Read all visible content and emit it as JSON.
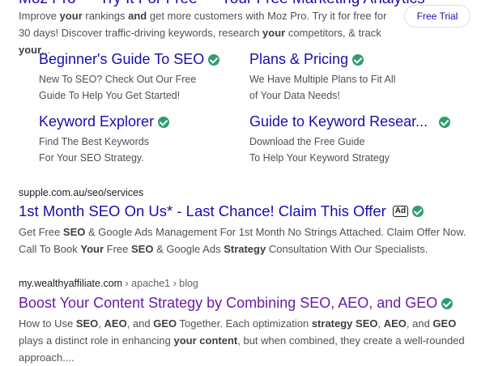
{
  "result_moz": {
    "title_clipped": "Moz Pro — Try It For Free — Your Free Marketing Analytics",
    "description_parts": [
      {
        "t": "Improve ",
        "b": false
      },
      {
        "t": "your",
        "b": true
      },
      {
        "t": " rankings ",
        "b": false
      },
      {
        "t": "and",
        "b": true
      },
      {
        "t": " get more customers with Moz Pro. Try it for free for 30 days! Discover traffic-driving keywords, research ",
        "b": false
      },
      {
        "t": "your",
        "b": true
      },
      {
        "t": " competitors, & track ",
        "b": false
      },
      {
        "t": "your",
        "b": true
      },
      {
        "t": "...",
        "b": false
      }
    ],
    "cta_label": "Free Trial",
    "sitelinks": [
      {
        "title": "Beginner's Guide To SEO",
        "line1": "New To SEO? Check Out Our Free",
        "line2": "Guide To Help You Get Started!"
      },
      {
        "title": "Plans & Pricing",
        "line1": "We Have Multiple Plans to Fit All",
        "line2": "of Your Data Needs!"
      },
      {
        "title": "Keyword Explorer",
        "line1": "Find The Best Keywords",
        "line2": "For Your SEO Strategy."
      },
      {
        "title": "Guide to Keyword Resear...",
        "line1": "Download the Free Guide",
        "line2": "To Help Your Keyword Strategy"
      }
    ]
  },
  "result_supple": {
    "url": "supple.com.au/seo/services",
    "title": "1st Month SEO On Us* - Last Chance! Claim This Offer",
    "ad_label": "Ad",
    "description_parts": [
      {
        "t": "Get Free ",
        "b": false
      },
      {
        "t": "SEO",
        "b": true
      },
      {
        "t": " & Google Ads Management For 1st Month No Strings Attached. Claim Offer Now. Call To Book ",
        "b": false
      },
      {
        "t": "Your",
        "b": true
      },
      {
        "t": " Free ",
        "b": false
      },
      {
        "t": "SEO",
        "b": true
      },
      {
        "t": " & Google Ads ",
        "b": false
      },
      {
        "t": "Strategy",
        "b": true
      },
      {
        "t": " Consultation With Our Specialists.",
        "b": false
      }
    ]
  },
  "result_wealthy": {
    "url_domain": "my.wealthyaffiliate.com",
    "url_crumbs": " › apache1 › blog",
    "title": "Boost Your Content Strategy by Combining SEO, AEO, and GEO",
    "description_parts": [
      {
        "t": "How to Use ",
        "b": false
      },
      {
        "t": "SEO",
        "b": true
      },
      {
        "t": ", ",
        "b": false
      },
      {
        "t": "AEO",
        "b": true
      },
      {
        "t": ", and ",
        "b": false
      },
      {
        "t": "GEO",
        "b": true
      },
      {
        "t": " Together. Each optimization ",
        "b": false
      },
      {
        "t": "strategy SEO",
        "b": true
      },
      {
        "t": ", ",
        "b": false
      },
      {
        "t": "AEO",
        "b": true
      },
      {
        "t": ", and ",
        "b": false
      },
      {
        "t": "GEO",
        "b": true
      },
      {
        "t": " plays a distinct role in enhancing ",
        "b": false
      },
      {
        "t": "your content",
        "b": true
      },
      {
        "t": ", but when combined, they create a well-rounded approach....",
        "b": false
      }
    ]
  },
  "colors": {
    "link": "#1a0dab",
    "visited": "#681da8",
    "verified": "#2e9e6f",
    "text": "#4d5156"
  }
}
